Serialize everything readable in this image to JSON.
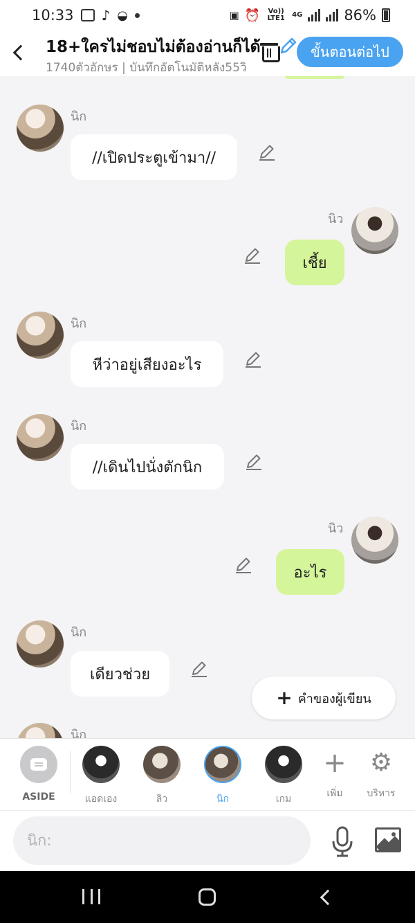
{
  "status_bar": {
    "time": "10:33",
    "battery": "86%",
    "network": "4G",
    "volte": "Vo)) LTE1"
  },
  "header": {
    "title": "18+ใครไม่ชอบไม่ต้องอ่านก็ได้",
    "subtitle": "1740ตัวอักษร | บันทึกอัตโนมัติหลัง55วิ",
    "next_label": "ขั้นตอนต่อไป"
  },
  "messages": [
    {
      "side": "left",
      "name": "นิก",
      "text": "//เปิดประตูเข้ามา//"
    },
    {
      "side": "right",
      "name": "นิว",
      "text": "เชี้ย"
    },
    {
      "side": "left",
      "name": "นิก",
      "text": "หีว่าอยู่เสียงอะไร"
    },
    {
      "side": "left",
      "name": "นิก",
      "text": "//เดินไปนั่งตักนิก"
    },
    {
      "side": "right",
      "name": "นิว",
      "text": "อะไร"
    },
    {
      "side": "left",
      "name": "นิก",
      "text": "เดียวช่วย"
    },
    {
      "side": "left",
      "name": "นิก",
      "text": ""
    }
  ],
  "fab": {
    "label": "คำของผู้เขียน"
  },
  "characters": {
    "aside_label": "ASIDE",
    "items": [
      {
        "label": "แอดเอง",
        "selected": false
      },
      {
        "label": "ลิว",
        "selected": false
      },
      {
        "label": "นิก",
        "selected": true
      },
      {
        "label": "เกม",
        "selected": false
      }
    ],
    "add_label": "เพิ่ม",
    "manage_label": "บริหาร"
  },
  "input": {
    "placeholder": "นิก:"
  },
  "colors": {
    "accent": "#4aa3f0",
    "bubble_right": "#d4f59a",
    "bubble_left": "#ffffff",
    "chat_bg": "#f4f4f6"
  }
}
